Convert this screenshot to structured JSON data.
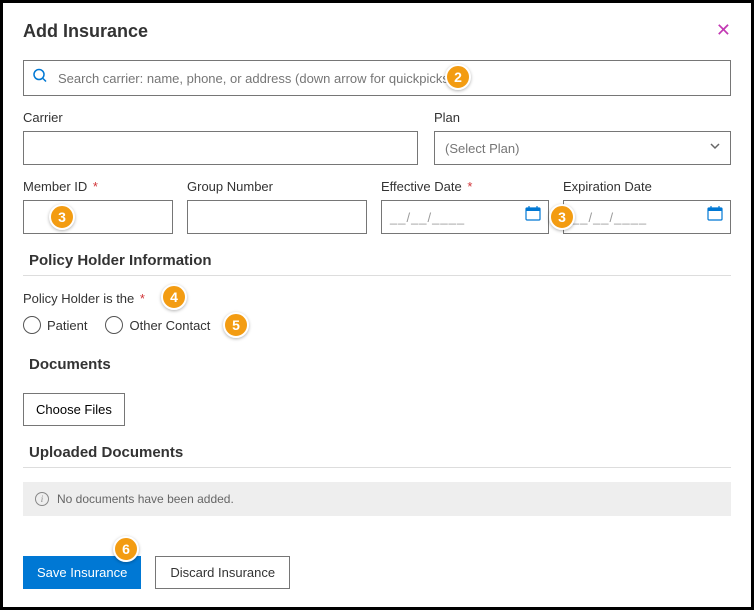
{
  "header": {
    "title": "Add Insurance"
  },
  "search": {
    "placeholder": "Search carrier: name, phone, or address (down arrow for quickpicks)"
  },
  "fields": {
    "carrier_label": "Carrier",
    "plan_label": "Plan",
    "plan_placeholder": "(Select Plan)",
    "member_id_label": "Member ID",
    "group_number_label": "Group Number",
    "effective_date_label": "Effective Date",
    "expiration_date_label": "Expiration Date",
    "date_placeholder": "__/__/____"
  },
  "policy": {
    "section_title": "Policy Holder Information",
    "holder_label": "Policy Holder is the",
    "option_patient": "Patient",
    "option_other": "Other Contact"
  },
  "documents": {
    "section_title": "Documents",
    "choose_label": "Choose Files",
    "uploaded_title": "Uploaded Documents",
    "empty_message": "No documents have been added."
  },
  "footer": {
    "save_label": "Save Insurance",
    "discard_label": "Discard Insurance"
  },
  "badges": {
    "b2": "2",
    "b3a": "3",
    "b3b": "3",
    "b4": "4",
    "b5": "5",
    "b6": "6"
  }
}
